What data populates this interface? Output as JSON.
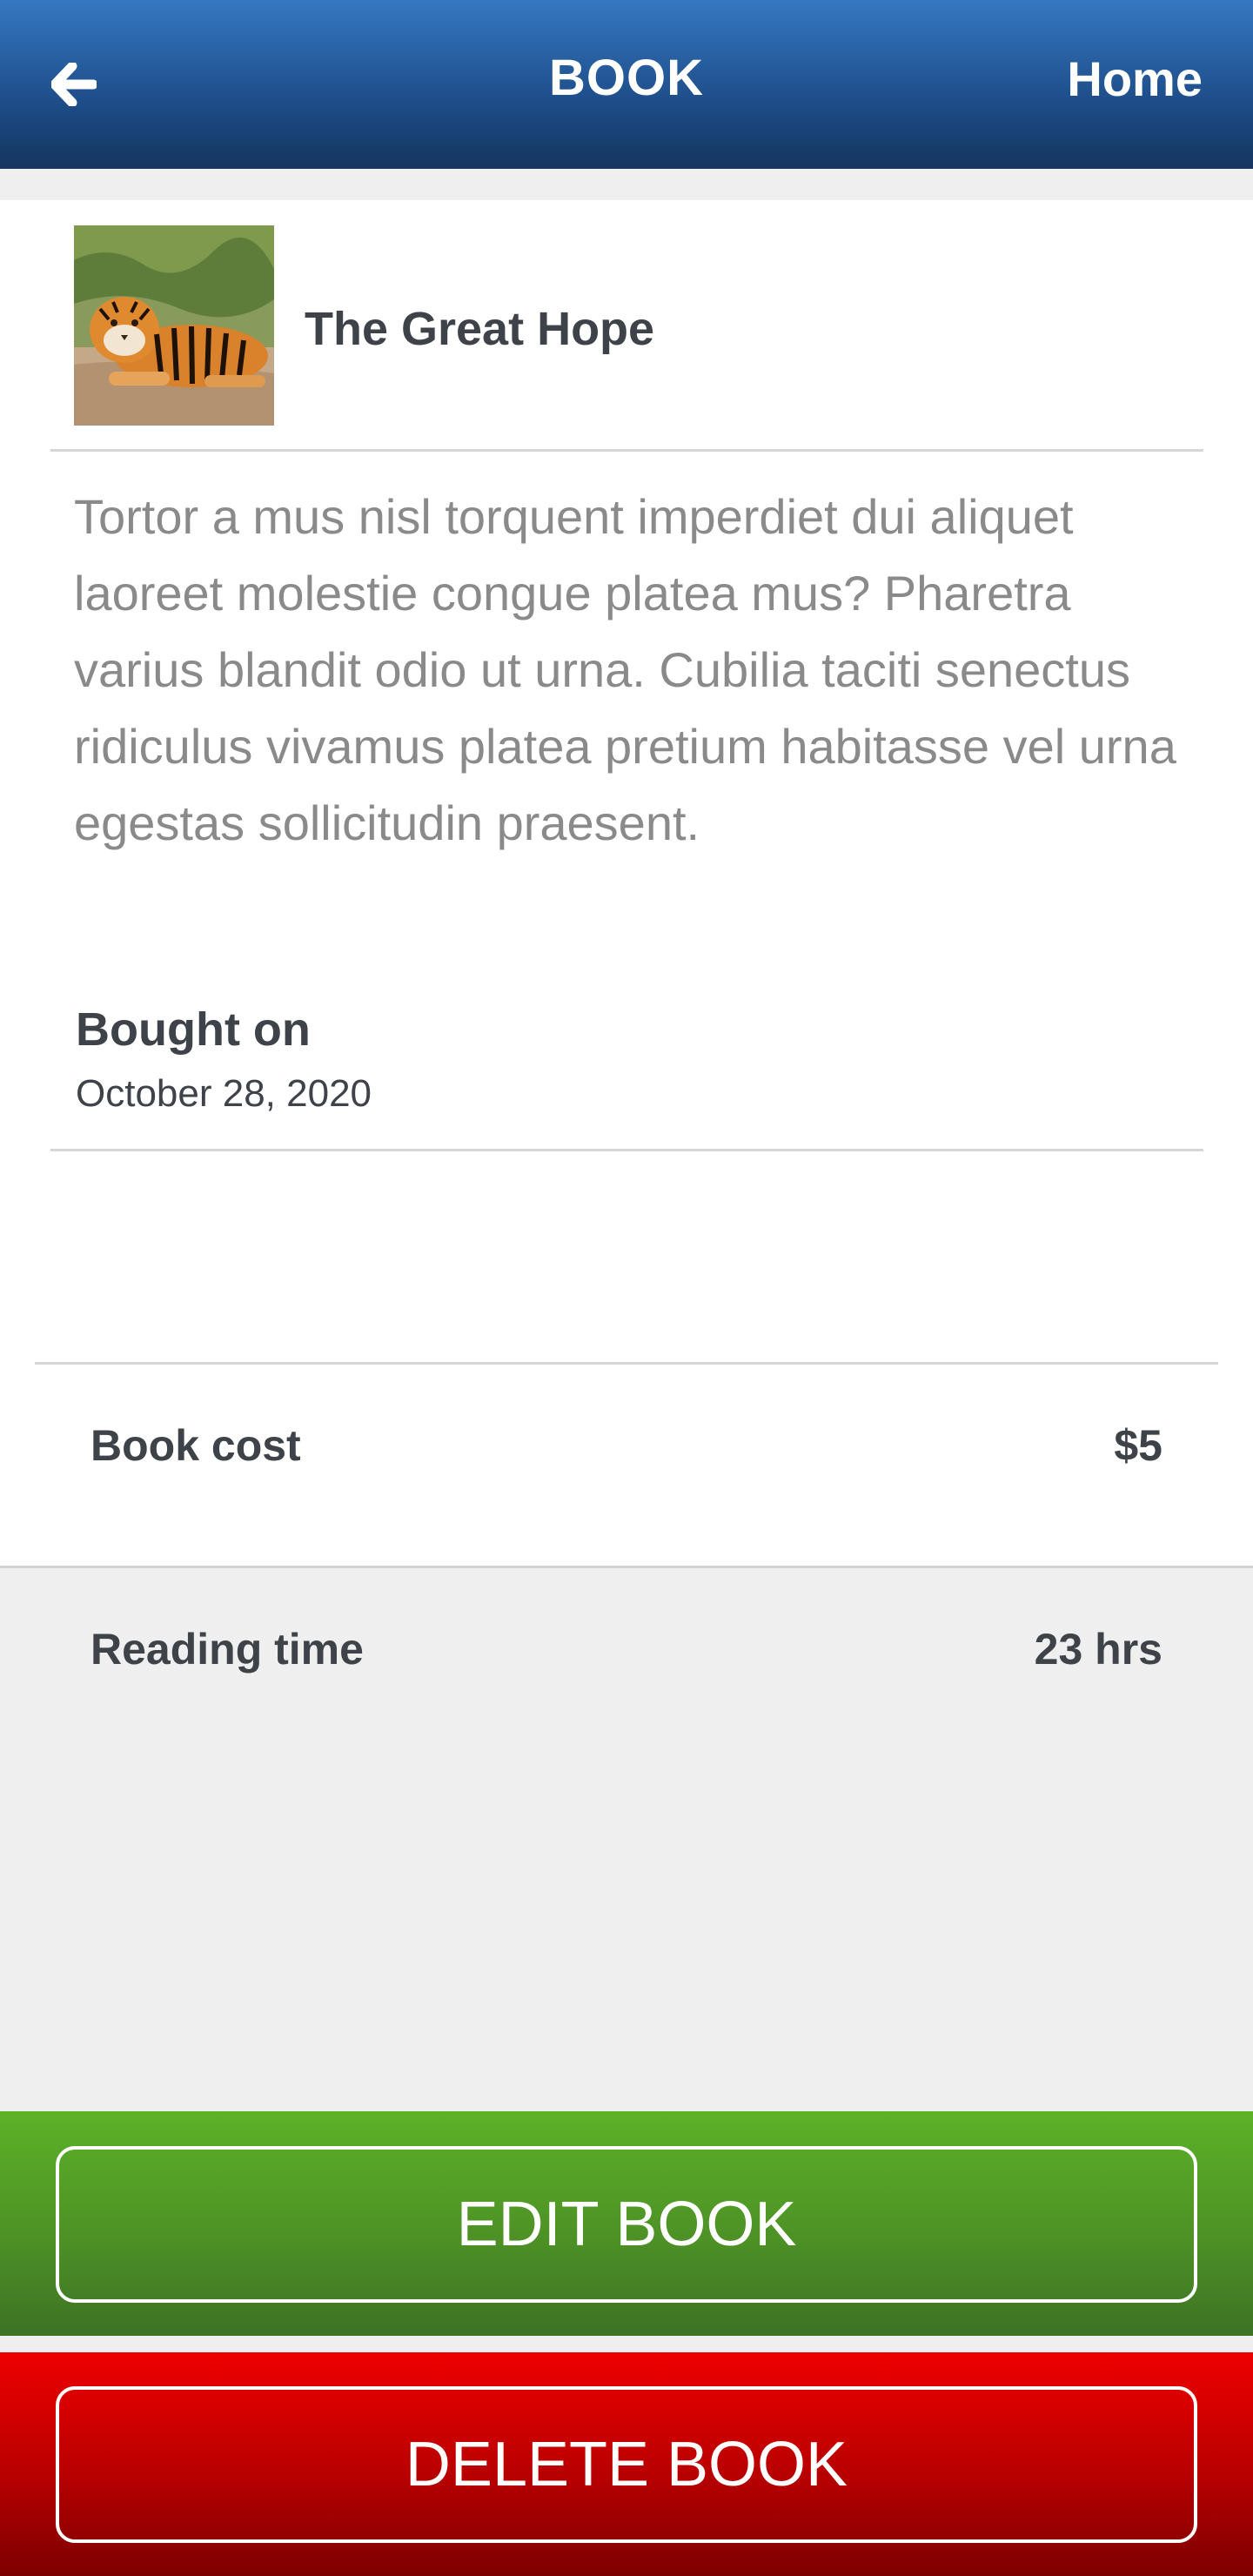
{
  "header": {
    "title": "BOOK",
    "home_label": "Home",
    "back_icon": "arrow-left-icon"
  },
  "book": {
    "title": "The Great Hope",
    "thumbnail_icon": "tiger-photo",
    "description": "Tortor a mus nisl torquent imperdiet dui aliquet laoreet molestie congue platea mus? Pharetra varius blandit odio ut urna. Cubilia taciti senectus ridiculus vivamus platea pretium habitasse vel urna egestas sollicitudin praesent.",
    "bought_label": "Bought on",
    "bought_date": "October 28, 2020"
  },
  "stats": [
    {
      "label": "Book cost",
      "value": "$5"
    },
    {
      "label": "Reading time",
      "value": "23 hrs"
    }
  ],
  "actions": {
    "edit_label": "EDIT BOOK",
    "delete_label": "DELETE BOOK"
  },
  "colors": {
    "header_blue": "#1c4a85",
    "edit_green": "#4e9226",
    "delete_red": "#b80000",
    "text_dark": "#3e434a",
    "text_muted": "#8a8a8a"
  }
}
